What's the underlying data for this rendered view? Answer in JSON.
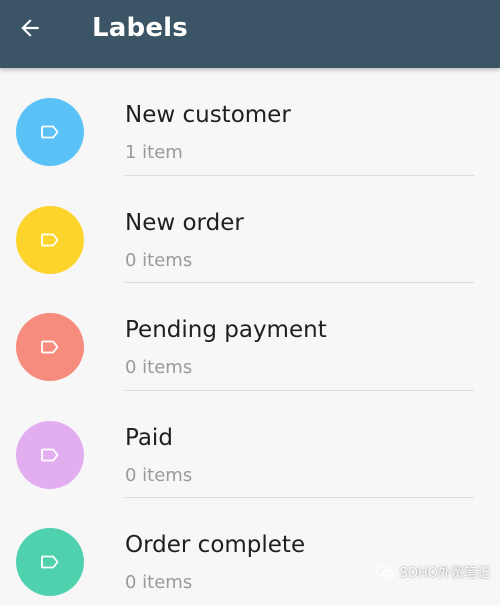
{
  "header": {
    "title": "Labels",
    "background": "#3b5566",
    "back_icon": "arrow-left-icon"
  },
  "labels": [
    {
      "name": "New customer",
      "count_text": "1 item",
      "color": "#5bc2f7"
    },
    {
      "name": "New order",
      "count_text": "0 items",
      "color": "#fcd42c"
    },
    {
      "name": "Pending payment",
      "count_text": "0 items",
      "color": "#f68c7e"
    },
    {
      "name": "Paid",
      "count_text": "0 items",
      "color": "#e3aef0"
    },
    {
      "name": "Order complete",
      "count_text": "0 items",
      "color": "#4fd1ae"
    }
  ],
  "label_icon": "tag-icon",
  "watermark": {
    "text": "SOHO外贸笔记",
    "icon": "wechat-icon"
  }
}
